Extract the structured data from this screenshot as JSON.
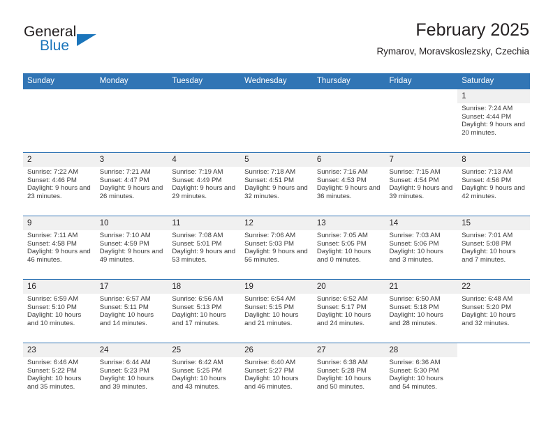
{
  "brand": {
    "name_top": "General",
    "name_bottom": "Blue",
    "accent_color": "#1b75bb",
    "flag_icon": "triangle-flag-icon"
  },
  "header": {
    "title": "February 2025",
    "location": "Rymarov, Moravskoslezsky, Czechia"
  },
  "theme": {
    "header_blue": "#3175b5",
    "daynum_band": "#f0f0f0",
    "text": "#231f20"
  },
  "calendar": {
    "weekday_headers": [
      "Sunday",
      "Monday",
      "Tuesday",
      "Wednesday",
      "Thursday",
      "Friday",
      "Saturday"
    ],
    "weeks": [
      [
        {
          "empty": true
        },
        {
          "empty": true
        },
        {
          "empty": true
        },
        {
          "empty": true
        },
        {
          "empty": true
        },
        {
          "empty": true
        },
        {
          "day": "1",
          "sunrise": "Sunrise: 7:24 AM",
          "sunset": "Sunset: 4:44 PM",
          "daylight": "Daylight: 9 hours and 20 minutes."
        }
      ],
      [
        {
          "day": "2",
          "sunrise": "Sunrise: 7:22 AM",
          "sunset": "Sunset: 4:46 PM",
          "daylight": "Daylight: 9 hours and 23 minutes."
        },
        {
          "day": "3",
          "sunrise": "Sunrise: 7:21 AM",
          "sunset": "Sunset: 4:47 PM",
          "daylight": "Daylight: 9 hours and 26 minutes."
        },
        {
          "day": "4",
          "sunrise": "Sunrise: 7:19 AM",
          "sunset": "Sunset: 4:49 PM",
          "daylight": "Daylight: 9 hours and 29 minutes."
        },
        {
          "day": "5",
          "sunrise": "Sunrise: 7:18 AM",
          "sunset": "Sunset: 4:51 PM",
          "daylight": "Daylight: 9 hours and 32 minutes."
        },
        {
          "day": "6",
          "sunrise": "Sunrise: 7:16 AM",
          "sunset": "Sunset: 4:53 PM",
          "daylight": "Daylight: 9 hours and 36 minutes."
        },
        {
          "day": "7",
          "sunrise": "Sunrise: 7:15 AM",
          "sunset": "Sunset: 4:54 PM",
          "daylight": "Daylight: 9 hours and 39 minutes."
        },
        {
          "day": "8",
          "sunrise": "Sunrise: 7:13 AM",
          "sunset": "Sunset: 4:56 PM",
          "daylight": "Daylight: 9 hours and 42 minutes."
        }
      ],
      [
        {
          "day": "9",
          "sunrise": "Sunrise: 7:11 AM",
          "sunset": "Sunset: 4:58 PM",
          "daylight": "Daylight: 9 hours and 46 minutes."
        },
        {
          "day": "10",
          "sunrise": "Sunrise: 7:10 AM",
          "sunset": "Sunset: 4:59 PM",
          "daylight": "Daylight: 9 hours and 49 minutes."
        },
        {
          "day": "11",
          "sunrise": "Sunrise: 7:08 AM",
          "sunset": "Sunset: 5:01 PM",
          "daylight": "Daylight: 9 hours and 53 minutes."
        },
        {
          "day": "12",
          "sunrise": "Sunrise: 7:06 AM",
          "sunset": "Sunset: 5:03 PM",
          "daylight": "Daylight: 9 hours and 56 minutes."
        },
        {
          "day": "13",
          "sunrise": "Sunrise: 7:05 AM",
          "sunset": "Sunset: 5:05 PM",
          "daylight": "Daylight: 10 hours and 0 minutes."
        },
        {
          "day": "14",
          "sunrise": "Sunrise: 7:03 AM",
          "sunset": "Sunset: 5:06 PM",
          "daylight": "Daylight: 10 hours and 3 minutes."
        },
        {
          "day": "15",
          "sunrise": "Sunrise: 7:01 AM",
          "sunset": "Sunset: 5:08 PM",
          "daylight": "Daylight: 10 hours and 7 minutes."
        }
      ],
      [
        {
          "day": "16",
          "sunrise": "Sunrise: 6:59 AM",
          "sunset": "Sunset: 5:10 PM",
          "daylight": "Daylight: 10 hours and 10 minutes."
        },
        {
          "day": "17",
          "sunrise": "Sunrise: 6:57 AM",
          "sunset": "Sunset: 5:11 PM",
          "daylight": "Daylight: 10 hours and 14 minutes."
        },
        {
          "day": "18",
          "sunrise": "Sunrise: 6:56 AM",
          "sunset": "Sunset: 5:13 PM",
          "daylight": "Daylight: 10 hours and 17 minutes."
        },
        {
          "day": "19",
          "sunrise": "Sunrise: 6:54 AM",
          "sunset": "Sunset: 5:15 PM",
          "daylight": "Daylight: 10 hours and 21 minutes."
        },
        {
          "day": "20",
          "sunrise": "Sunrise: 6:52 AM",
          "sunset": "Sunset: 5:17 PM",
          "daylight": "Daylight: 10 hours and 24 minutes."
        },
        {
          "day": "21",
          "sunrise": "Sunrise: 6:50 AM",
          "sunset": "Sunset: 5:18 PM",
          "daylight": "Daylight: 10 hours and 28 minutes."
        },
        {
          "day": "22",
          "sunrise": "Sunrise: 6:48 AM",
          "sunset": "Sunset: 5:20 PM",
          "daylight": "Daylight: 10 hours and 32 minutes."
        }
      ],
      [
        {
          "day": "23",
          "sunrise": "Sunrise: 6:46 AM",
          "sunset": "Sunset: 5:22 PM",
          "daylight": "Daylight: 10 hours and 35 minutes."
        },
        {
          "day": "24",
          "sunrise": "Sunrise: 6:44 AM",
          "sunset": "Sunset: 5:23 PM",
          "daylight": "Daylight: 10 hours and 39 minutes."
        },
        {
          "day": "25",
          "sunrise": "Sunrise: 6:42 AM",
          "sunset": "Sunset: 5:25 PM",
          "daylight": "Daylight: 10 hours and 43 minutes."
        },
        {
          "day": "26",
          "sunrise": "Sunrise: 6:40 AM",
          "sunset": "Sunset: 5:27 PM",
          "daylight": "Daylight: 10 hours and 46 minutes."
        },
        {
          "day": "27",
          "sunrise": "Sunrise: 6:38 AM",
          "sunset": "Sunset: 5:28 PM",
          "daylight": "Daylight: 10 hours and 50 minutes."
        },
        {
          "day": "28",
          "sunrise": "Sunrise: 6:36 AM",
          "sunset": "Sunset: 5:30 PM",
          "daylight": "Daylight: 10 hours and 54 minutes."
        },
        {
          "empty": true
        }
      ]
    ]
  }
}
